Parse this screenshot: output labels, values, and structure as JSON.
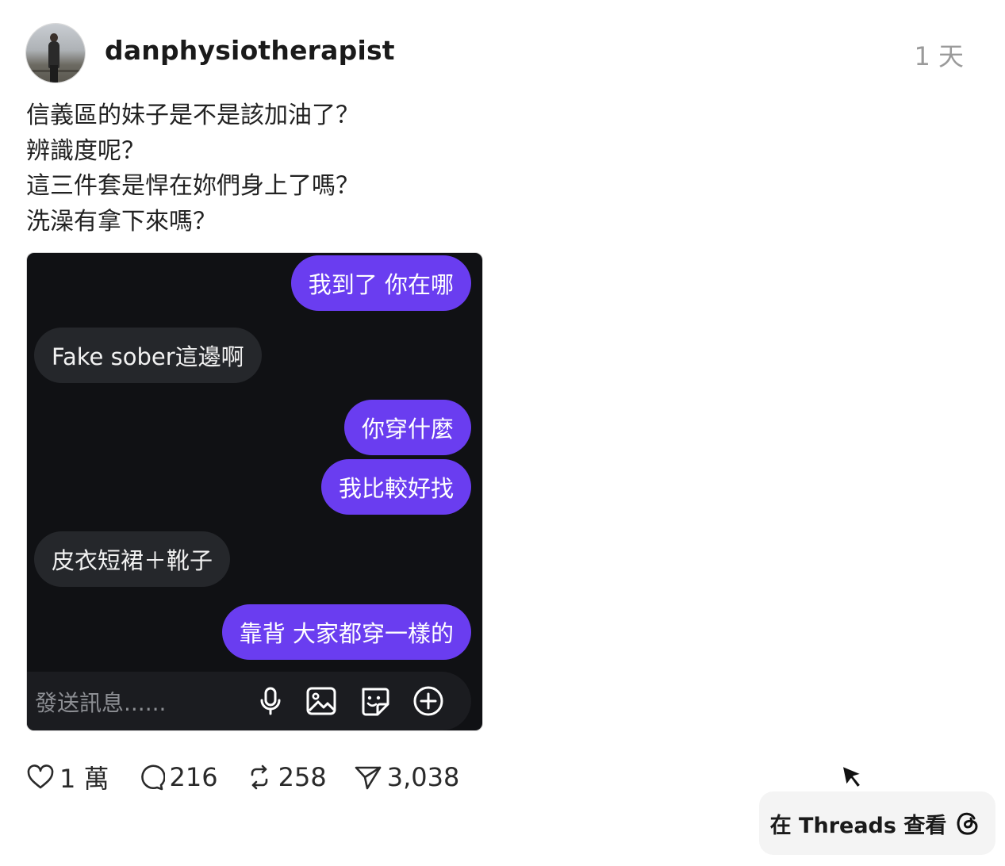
{
  "post": {
    "username": "danphysiotherapist",
    "timestamp": "1 天",
    "text_lines": [
      "信義區的妹子是不是該加油了？",
      "辨識度呢？",
      "這三件套是悍在妳們身上了嗎？",
      "洗澡有拿下來嗎？"
    ]
  },
  "chat": {
    "messages": [
      {
        "from": "me",
        "text": "我到了 你在哪"
      },
      {
        "from": "them",
        "text": "Fake sober這邊啊"
      },
      {
        "from": "me",
        "text": "你穿什麼"
      },
      {
        "from": "me",
        "text": "我比較好找"
      },
      {
        "from": "them",
        "text": "皮衣短裙＋靴子"
      },
      {
        "from": "me",
        "text": "靠背 大家都穿一樣的"
      }
    ],
    "composer_placeholder": "發送訊息......",
    "composer_icons": [
      "microphone-icon",
      "image-icon",
      "sticker-icon",
      "plus-circle-icon"
    ],
    "colors": {
      "outgoing": "#6a3df0",
      "incoming": "#25272b",
      "background": "#101114"
    }
  },
  "actions": {
    "likes": "1 萬",
    "comments": "216",
    "reposts": "258",
    "shares": "3,038"
  },
  "cta": {
    "label": "在 Threads 查看",
    "icon": "threads-logo-icon"
  }
}
